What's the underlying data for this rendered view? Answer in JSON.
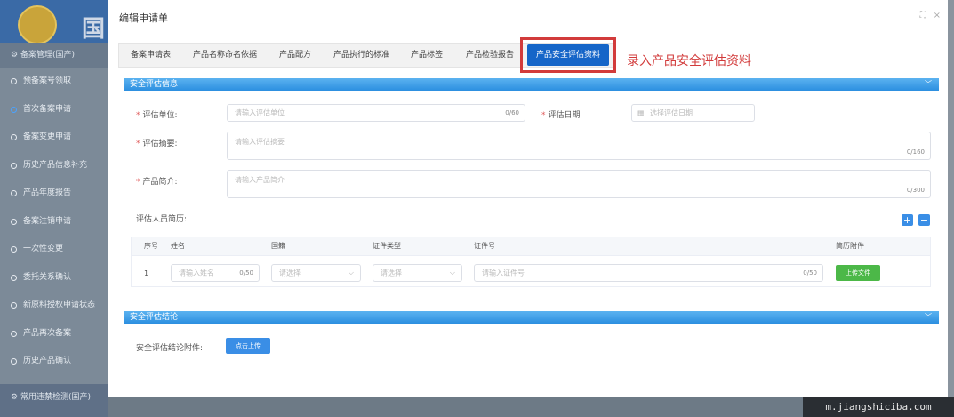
{
  "background": {
    "title_char": "国",
    "sidebar": {
      "header": "备案管理(国产)",
      "items": [
        {
          "label": "预备案号领取",
          "active": false
        },
        {
          "label": "首次备案申请",
          "active": true
        },
        {
          "label": "备案变更申请",
          "active": false
        },
        {
          "label": "历史产品信息补充",
          "active": false
        },
        {
          "label": "产品年度报告",
          "active": false
        },
        {
          "label": "备案注销申请",
          "active": false
        },
        {
          "label": "一次性变更",
          "active": false
        },
        {
          "label": "委托关系确认",
          "active": false
        },
        {
          "label": "新原料授权申请状态",
          "active": false
        },
        {
          "label": "产品再次备案",
          "active": false
        },
        {
          "label": "历史产品确认",
          "active": false
        }
      ],
      "footer": "常用违禁检测(国产)"
    }
  },
  "modal": {
    "title": "编辑申请单",
    "actions": {
      "fullscreen": "⛶",
      "close": "×"
    },
    "tabs": [
      {
        "label": "备案申请表"
      },
      {
        "label": "产品名称命名依据"
      },
      {
        "label": "产品配方"
      },
      {
        "label": "产品执行的标准"
      },
      {
        "label": "产品标签"
      },
      {
        "label": "产品检验报告"
      },
      {
        "label": "产品安全评估资料"
      }
    ],
    "annotation": "录入产品安全评估资料",
    "section1": {
      "title": "安全评估信息",
      "unit_label": "评估单位:",
      "unit_placeholder": "请输入评估单位",
      "unit_count": "0/60",
      "date_label": "评估日期",
      "date_placeholder": "选择评估日期",
      "summary_label": "评估摘要:",
      "summary_placeholder": "请输入评估摘要",
      "summary_count": "0/160",
      "intro_label": "产品简介:",
      "intro_placeholder": "请输入产品简介",
      "intro_count": "0/300",
      "resume_label": "评估人员简历:",
      "table": {
        "headers": [
          "序号",
          "姓名",
          "国籍",
          "证件类型",
          "证件号",
          "简历附件"
        ],
        "rows": [
          {
            "index": "1",
            "name_placeholder": "请输入姓名",
            "name_count": "0/50",
            "nationality_placeholder": "请选择",
            "idtype_placeholder": "请选择",
            "idno_placeholder": "请输入证件号",
            "idno_count": "0/50",
            "upload_label": "上传文件"
          }
        ]
      }
    },
    "section2": {
      "title": "安全评估结论",
      "attachment_label": "安全评估结论附件:",
      "upload_label": "点击上传"
    }
  },
  "watermark": "m.jiangshiciba.com"
}
